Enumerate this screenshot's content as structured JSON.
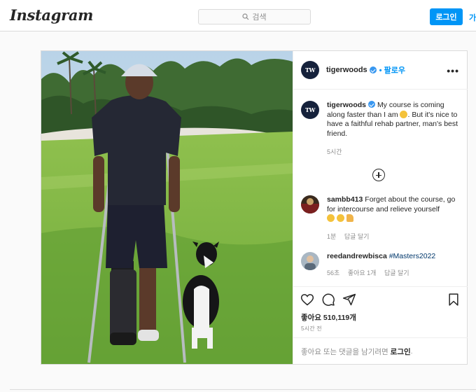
{
  "header": {
    "logo": "Instagram",
    "search_placeholder": "검색",
    "login_label": "로그인",
    "signup_label": "가입하기"
  },
  "post": {
    "author": "tigerwoods",
    "author_avatar_text": "TW",
    "follow_label": "팔로우",
    "more_label": "•••",
    "caption_part1": "My course is coming along faster than I am",
    "caption_part2": ". But it's nice to have a faithful rehab partner, man's best friend.",
    "caption_time": "5시간",
    "comments": [
      {
        "username": "sambb413",
        "text": "Forget about the course, go for intercourse and relieve yourself",
        "time": "1분",
        "reply_label": "답글 달기"
      },
      {
        "username": "reedandrewbisca",
        "text": "#Masters2022",
        "time": "56초",
        "likes_label": "좋아요 1개",
        "reply_label": "답글 달기"
      }
    ],
    "likes_text": "좋아요 510,119개",
    "post_time": "5시간 전",
    "login_prompt": "좋아요 또는 댓글을 남기려면",
    "login_link": "로그인",
    "login_suffix": "."
  },
  "colors": {
    "accent": "#0095f6",
    "verified": "#3897f0",
    "border": "#dbdbdb"
  }
}
